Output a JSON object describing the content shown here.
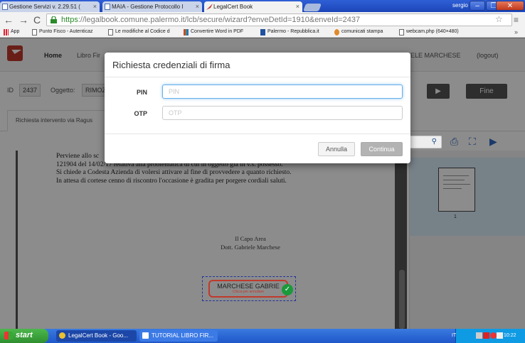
{
  "browser": {
    "tabs": [
      {
        "title": "Gestione Servizi v. 2.29.51 (",
        "active": false
      },
      {
        "title": "MAIA - Gestione Protocollo I",
        "active": false
      },
      {
        "title": "LegalCert Book",
        "active": true
      }
    ],
    "user": "sergio",
    "url_https": "https",
    "url_rest": "://legalbook.comune.palermo.it/lcb/secure/wizard?enveDetId=1910&enveId=2437",
    "bookmarks": [
      {
        "label": "App",
        "icon": "apps-icon"
      },
      {
        "label": "Punto Fisco - Autenticaz",
        "icon": "page-icon"
      },
      {
        "label": "Le modifiche al Codice d",
        "icon": "page-icon"
      },
      {
        "label": "Convertire Word in PDF",
        "icon": "pdf-icon"
      },
      {
        "label": "Palermo - Repubblica.it",
        "icon": "rep-icon"
      },
      {
        "label": "comunicati stampa",
        "icon": "orange-icon"
      },
      {
        "label": "webcam.php (640×480)",
        "icon": "page-icon"
      }
    ]
  },
  "app": {
    "nav": {
      "home": "Home",
      "libro": "Libro Fir",
      "user": "ELE MARCHESE",
      "logout": "(logout)"
    },
    "id_label": "ID",
    "id_value": "2437",
    "oggetto_label": "Oggetto:",
    "oggetto_value": "RIMOZ",
    "fine_label": "Fine",
    "tab_label": "Richiesta intervento via Ragus",
    "document_lines": [
      "Perviene allo sc",
      "121904 del 14/02/17 relativa alla problematica di cui in oggetto già in v.s. possesso.",
      "Si chiede a Codesta Azienda di volersi attivare al fine di provvedere a quanto richiesto.",
      "In attesa di cortese cenno di riscontro l'occasione è gradita per porgere cordiali saluti."
    ],
    "signer_title": "Il Capo Area",
    "signer_name": "Dott. Gabriele Marchese",
    "signature_name": "MARCHESE GABRIE",
    "signature_sub": "Clicca per annullare",
    "thumb_page_number": "1"
  },
  "modal": {
    "title": "Richiesta credenziali di firma",
    "pin_label": "PIN",
    "pin_placeholder": "PIN",
    "otp_label": "OTP",
    "otp_placeholder": "OTP",
    "cancel_label": "Annulla",
    "continue_label": "Continua"
  },
  "taskbar": {
    "start_label": "start",
    "tasks": [
      {
        "label": "LegalCert Book - Goo..."
      },
      {
        "label": "TUTORIAL LIBRO FIR..."
      }
    ],
    "lang": "IT",
    "time": "10:22"
  },
  "colors": {
    "brand_red": "#c0392b",
    "focus_blue": "#66afe9",
    "xp_blue": "#1f57c9",
    "start_green": "#2f8f2f"
  }
}
